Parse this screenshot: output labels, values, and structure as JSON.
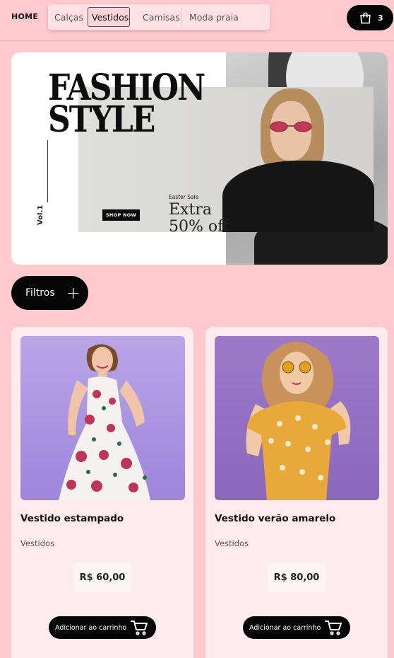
{
  "header": {
    "home_label": "HOME",
    "nav": [
      "Calças",
      "Vestidos",
      "Camisas",
      "Moda praia"
    ],
    "active_nav": "Vestidos",
    "cart_count": "3"
  },
  "banner": {
    "title_line1": "FASHION",
    "title_line2": "STYLE",
    "volume": "Vol.1",
    "eyebrow": "Easter Sale",
    "headline_line1": "Extra",
    "headline_line2": "50% off",
    "cta": "SHOP NOW"
  },
  "filters": {
    "label": "Filtros",
    "icon": "plus-icon"
  },
  "products": [
    {
      "name": "Vestido estampado",
      "category": "Vestidos",
      "price": "R$ 60,00",
      "button": "Adicionar ao carrinho"
    },
    {
      "name": "Vestido verão amarelo",
      "category": "Vestidos",
      "price": "R$ 80,00",
      "button": "Adicionar ao carrinho"
    }
  ],
  "colors": {
    "background": "#ffc9cd",
    "card": "#ffebed",
    "button": "#050505",
    "dress_yellow": "#e8a83a",
    "backdrop_purple": "#a58be0"
  }
}
